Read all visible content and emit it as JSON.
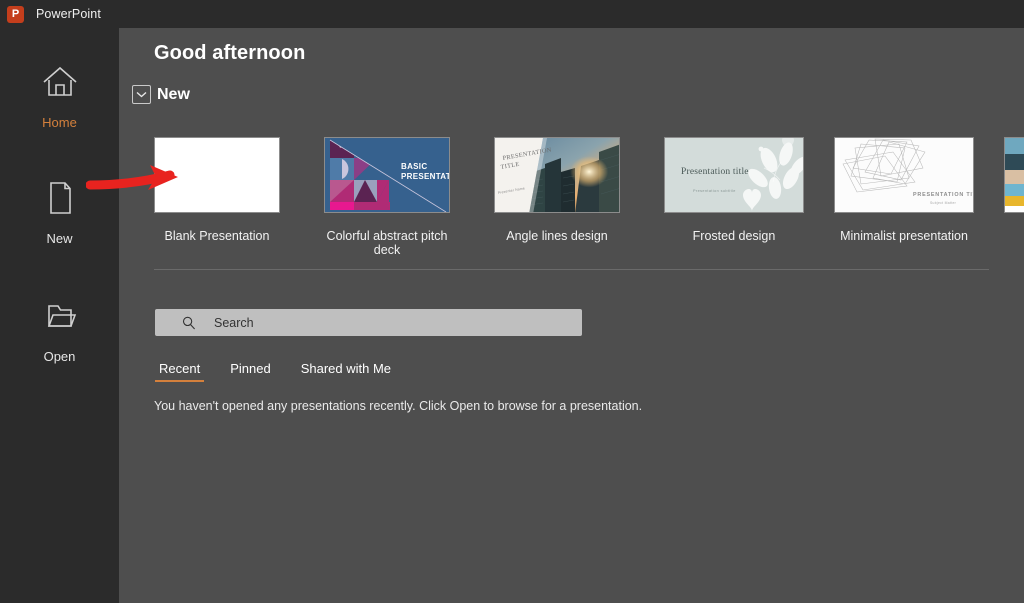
{
  "window": {
    "app_title": "PowerPoint",
    "logo_glyph": "P"
  },
  "sidebar": {
    "items": [
      {
        "label": "Home",
        "icon": "home-icon",
        "active": true
      },
      {
        "label": "New",
        "icon": "page-icon",
        "active": false
      },
      {
        "label": "Open",
        "icon": "folder-icon",
        "active": false
      }
    ]
  },
  "main": {
    "greeting": "Good afternoon",
    "new_section": {
      "label": "New",
      "collapse_icon": "chevron-down-icon"
    },
    "templates": [
      {
        "name": "Blank Presentation",
        "kind": "blank"
      },
      {
        "name": "Colorful abstract pitch deck",
        "kind": "abstract",
        "title_line1": "BASIC",
        "title_line2": "PRESENTATION"
      },
      {
        "name": "Angle lines design",
        "kind": "angle",
        "title": "PRESENTATION TITLE",
        "subtitle": "Presenter Name"
      },
      {
        "name": "Frosted design",
        "kind": "frosted",
        "title": "Presentation title",
        "subtitle": "Presentation subtitle"
      },
      {
        "name": "Minimalist presentation",
        "kind": "minimalist",
        "title": "PRESENTATION TITLE",
        "subtitle": "Subject Matter"
      },
      {
        "name": "",
        "kind": "partial"
      }
    ],
    "search": {
      "placeholder": "Search",
      "value": "",
      "icon": "search-icon"
    },
    "tabs": [
      {
        "label": "Recent",
        "active": true
      },
      {
        "label": "Pinned",
        "active": false
      },
      {
        "label": "Shared with Me",
        "active": false
      }
    ],
    "empty_state": "You haven't opened any presentations recently. Click Open to browse for a presentation."
  },
  "annotation": {
    "arrow": "red-arrow-pointing-right",
    "color": "#e8231f"
  },
  "colors": {
    "accent": "#d4803c",
    "brand": "#c43e1c",
    "rail_bg": "#2b2b2b",
    "content_bg": "#4e4e4e",
    "search_bg": "#bfbfbf"
  }
}
